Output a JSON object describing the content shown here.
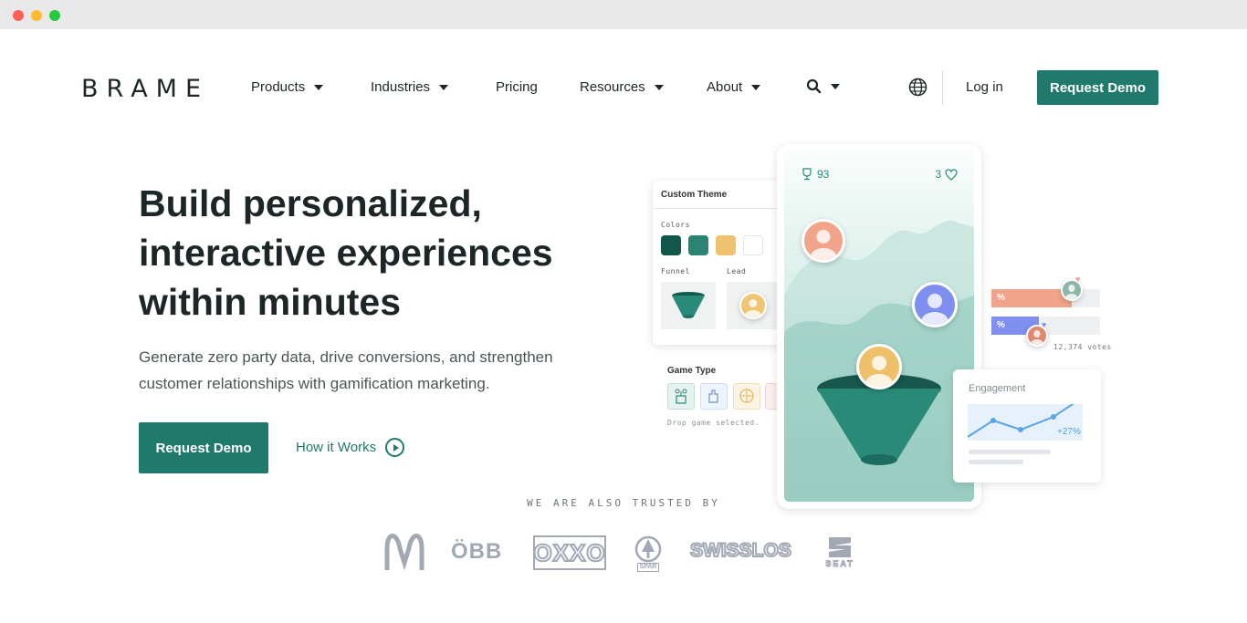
{
  "logo": "BRAME",
  "nav": {
    "items": [
      {
        "label": "Products",
        "dropdown": true
      },
      {
        "label": "Industries",
        "dropdown": true
      },
      {
        "label": "Pricing",
        "dropdown": false
      },
      {
        "label": "Resources",
        "dropdown": true
      },
      {
        "label": "About",
        "dropdown": true
      }
    ],
    "search_icon": "search-icon",
    "globe_icon": "globe-icon",
    "login": "Log in",
    "cta": "Request Demo"
  },
  "hero": {
    "headline": "Build personalized, interactive experiences within minutes",
    "subtext": "Generate zero party data, drive conversions, and strengthen customer relationships with gamification marketing.",
    "cta": "Request Demo",
    "secondary": "How it Works"
  },
  "illustration": {
    "theme_card": {
      "title": "Custom Theme",
      "colors_label": "Colors",
      "funnel_label": "Funnel",
      "lead_label": "Lead",
      "swatches": [
        "#12574b",
        "#2a8373",
        "#eec26e",
        "#ffffff"
      ]
    },
    "game_type": {
      "title": "Game Type",
      "hint": "Drop game selected."
    },
    "phone": {
      "trophy_score": "93",
      "lives": "3"
    },
    "poll": {
      "bar1_label": "%",
      "bar2_label": "%",
      "votes": "12,374 votes",
      "bar1_share": 0.74,
      "bar2_share": 0.44
    },
    "engagement": {
      "title": "Engagement",
      "change": "+27%"
    }
  },
  "trusted": {
    "label": "WE ARE ALSO TRUSTED BY",
    "brands": [
      "ÖBB",
      "OXXO",
      "SPAR",
      "SWISSLOS",
      "SEAT"
    ]
  },
  "colors": {
    "brand": "#1f7a6b",
    "text": "#1d2626",
    "logo_grey": "#a3a8b5"
  }
}
